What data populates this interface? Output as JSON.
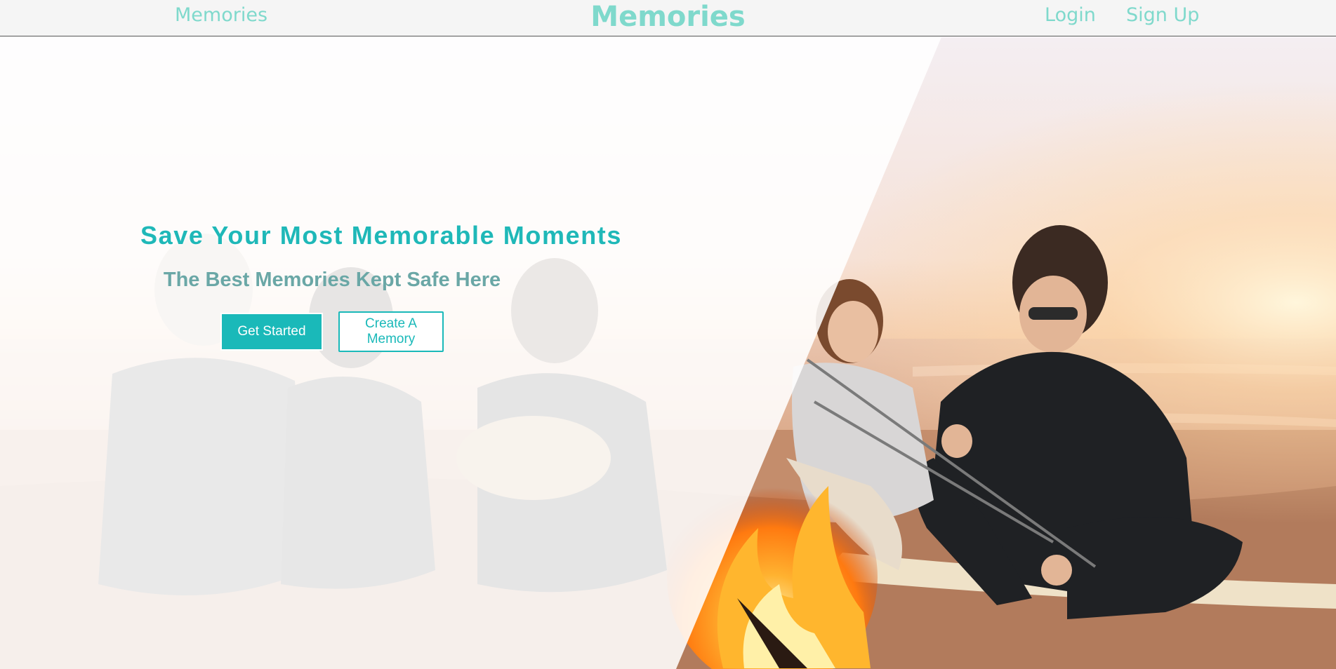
{
  "nav": {
    "left_link": "Memories",
    "brand": "Memories",
    "login": "Login",
    "signup": "Sign Up"
  },
  "hero": {
    "headline": "Save Your Most Memorable Moments",
    "subheadline": "The Best Memories Kept Safe Here",
    "primary_button": "Get Started",
    "secondary_button": "Create A Memory",
    "photo_description_icon": "beach-campfire-photo"
  },
  "colors": {
    "accent": "#1ab9b9",
    "nav_text": "#7fd9cc",
    "subheadline": "#6aa7a6",
    "nav_background": "#f5f5f5"
  }
}
